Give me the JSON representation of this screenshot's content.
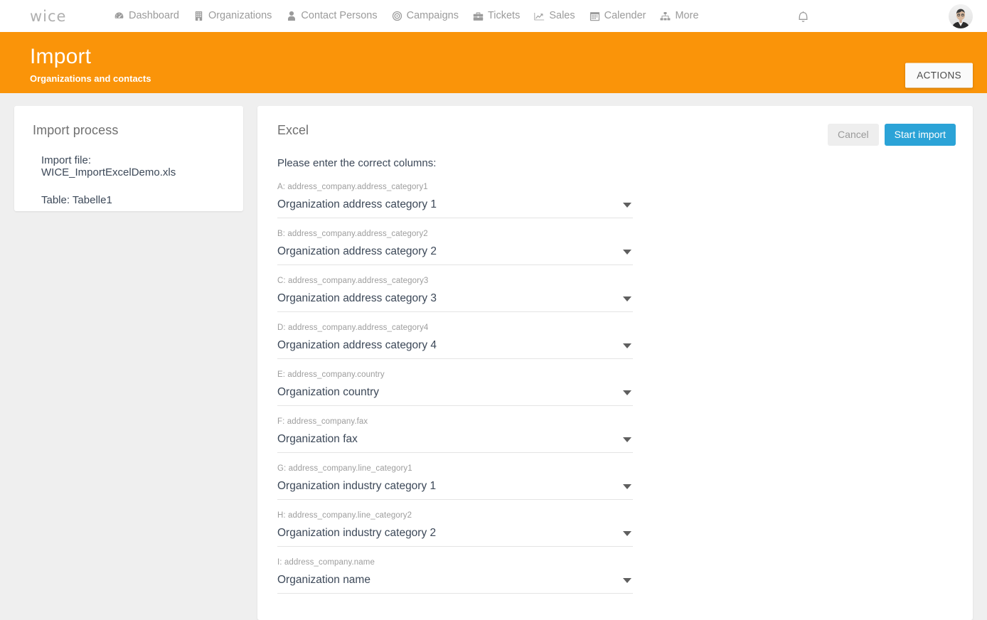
{
  "navbar": {
    "brand": "wice",
    "items": [
      {
        "label": "Dashboard",
        "icon": "dashboard-icon"
      },
      {
        "label": "Organizations",
        "icon": "building-icon"
      },
      {
        "label": "Contact Persons",
        "icon": "person-icon"
      },
      {
        "label": "Campaigns",
        "icon": "target-icon"
      },
      {
        "label": "Tickets",
        "icon": "briefcase-icon"
      },
      {
        "label": "Sales",
        "icon": "chart-line-icon"
      },
      {
        "label": "Calender",
        "icon": "calendar-icon"
      },
      {
        "label": "More",
        "icon": "sitemap-icon"
      }
    ],
    "notifications_icon": "bell-icon",
    "avatar_icon": "user-avatar"
  },
  "header": {
    "title": "Import",
    "subtitle": "Organizations and contacts",
    "actions_label": "ACTIONS",
    "accent_color": "#fa9409"
  },
  "sidebar": {
    "heading": "Import process",
    "import_file": "Import file: WICE_ImportExcelDemo.xls",
    "table": "Table: Tabelle1"
  },
  "main": {
    "heading": "Excel",
    "cancel_label": "Cancel",
    "start_label": "Start import",
    "primary_color": "#2ba3d7",
    "instruction": "Please enter the correct columns:",
    "fields": [
      {
        "label": "A: address_company.address_category1",
        "value": "Organization address category 1"
      },
      {
        "label": "B: address_company.address_category2",
        "value": "Organization address category 2"
      },
      {
        "label": "C: address_company.address_category3",
        "value": "Organization address category 3"
      },
      {
        "label": "D: address_company.address_category4",
        "value": "Organization address category 4"
      },
      {
        "label": "E: address_company.country",
        "value": "Organization country"
      },
      {
        "label": "F: address_company.fax",
        "value": "Organization fax"
      },
      {
        "label": "G: address_company.line_category1",
        "value": "Organization industry category 1"
      },
      {
        "label": "H: address_company.line_category2",
        "value": "Organization industry category 2"
      },
      {
        "label": "I: address_company.name",
        "value": "Organization name"
      }
    ]
  }
}
